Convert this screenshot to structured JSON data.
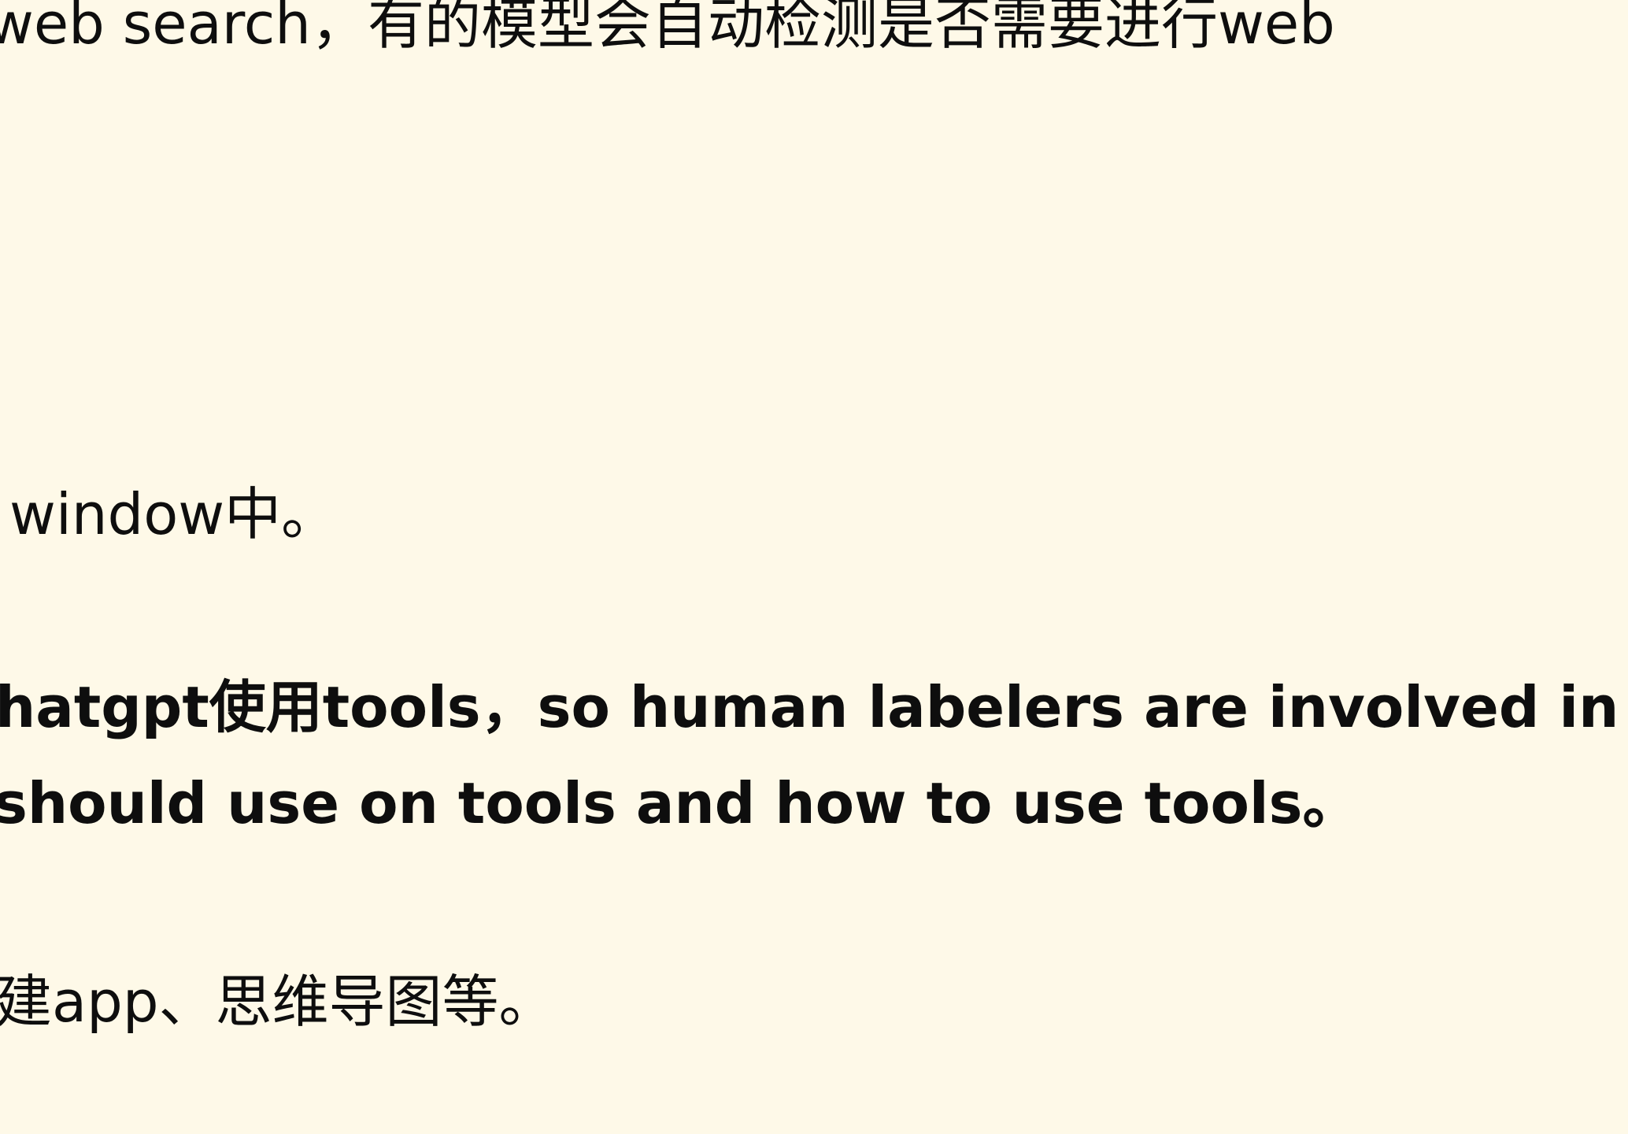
{
  "document": {
    "paragraphs": [
      {
        "text": "web search，有的模型会自动检测是否需要进行web",
        "bold": false
      },
      {
        "text": "window中。",
        "bold": false
      },
      {
        "text": "hatgpt使用tools，so human labelers are involved in",
        "bold": true
      },
      {
        "text": "should use on tools and how to use tools。",
        "bold": true
      },
      {
        "text": "建app、思维导图等。",
        "bold": false
      }
    ]
  }
}
